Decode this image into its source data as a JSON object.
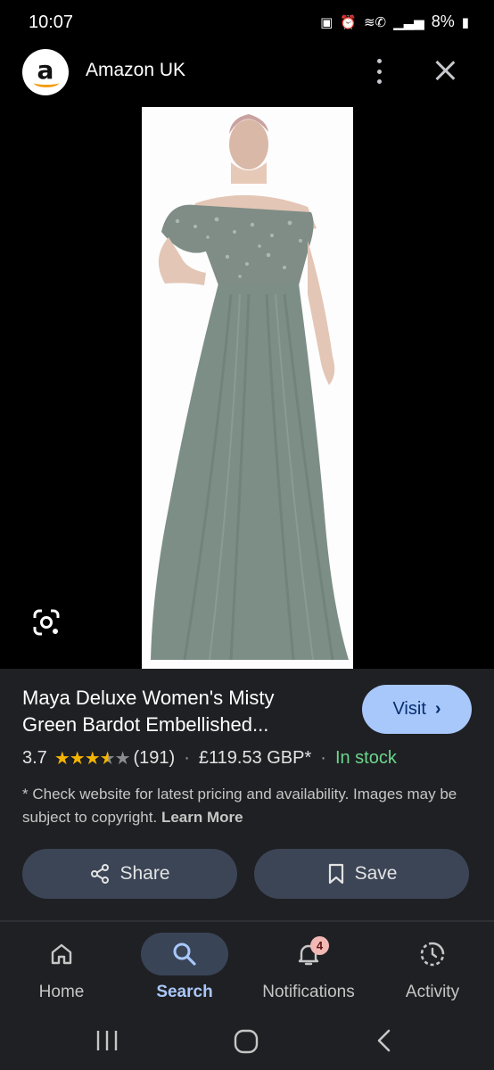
{
  "status_bar": {
    "time": "10:07",
    "battery": "8%"
  },
  "header": {
    "title": "Amazon UK",
    "logo_letter": "a"
  },
  "product": {
    "title_line1": "Maya Deluxe Women's Misty",
    "title_line2": "Green Bardot Embellished...",
    "visit_label": "Visit",
    "rating": "3.7",
    "rating_value": 3.7,
    "rating_max": 5,
    "reviews": "(191)",
    "price": "£119.53 GBP*",
    "availability": "In stock",
    "disclaimer": "* Check website for latest pricing and availability. Images may be subject to copyright.",
    "learn_more": "Learn More"
  },
  "actions": {
    "share_label": "Share",
    "save_label": "Save"
  },
  "bottom_nav": {
    "items": [
      {
        "label": "Home",
        "icon": "home-icon"
      },
      {
        "label": "Search",
        "icon": "search-icon"
      },
      {
        "label": "Notifications",
        "icon": "bell-icon",
        "badge": "4"
      },
      {
        "label": "Activity",
        "icon": "activity-icon"
      }
    ],
    "active": "Search"
  },
  "colors": {
    "visit_button": "#a8c7fa",
    "in_stock": "#6dd58c",
    "star": "#f5b400",
    "active_nav": "#a8c7fa",
    "action_button": "#3b4556"
  }
}
